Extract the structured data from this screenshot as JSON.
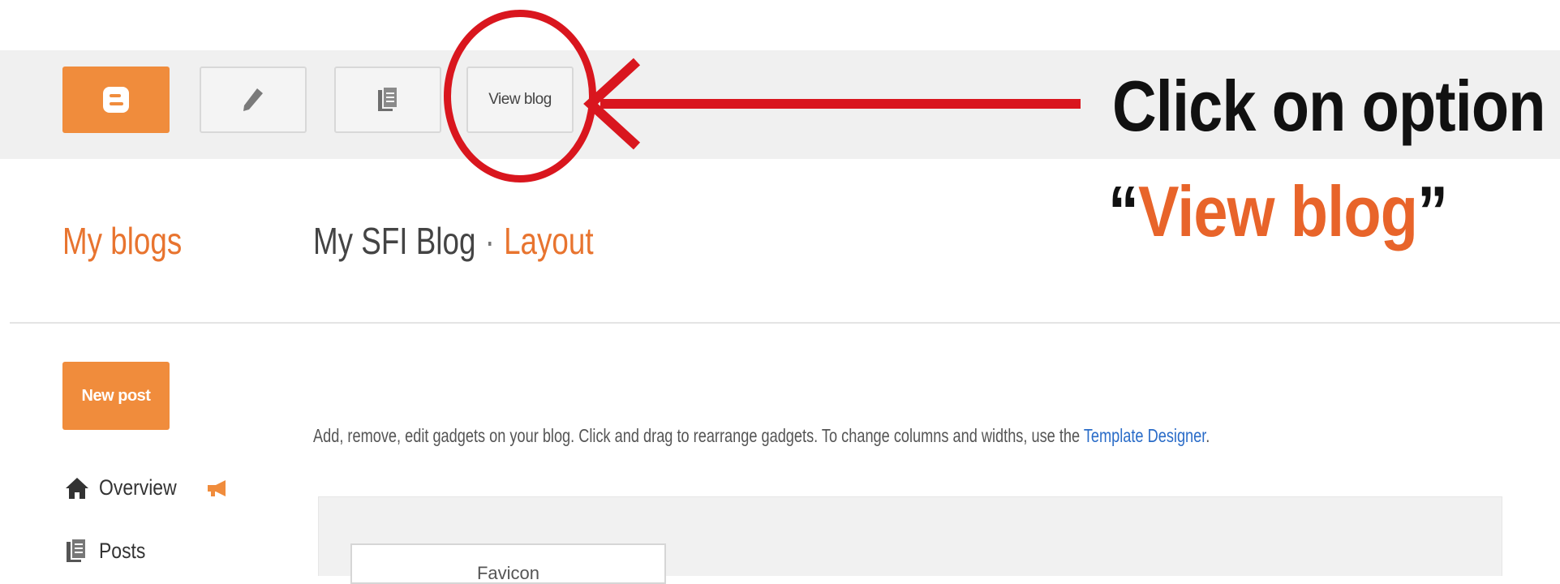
{
  "toolbar": {
    "blogger_logo": "blogger-logo-icon",
    "edit_icon": "pencil-icon",
    "pages_icon": "document-icon",
    "view_blog_label": "View blog"
  },
  "annotation": {
    "line1": "Click on option",
    "line2_open_quote": "“",
    "line2_highlight": "View blog",
    "line2_close_quote": "”",
    "circle_color": "#d9161e",
    "highlight_color": "#e8642a"
  },
  "header": {
    "my_blogs": "My blogs",
    "blog_name": "My SFI Blog",
    "separator": "·",
    "page": "Layout"
  },
  "sidebar": {
    "new_post_label": "New post",
    "items": [
      {
        "label": "Overview",
        "icon": "home-icon",
        "badge_icon": "megaphone-icon"
      },
      {
        "label": "Posts",
        "icon": "posts-icon"
      }
    ]
  },
  "main": {
    "description": "Add, remove, edit gadgets on your blog. Click and drag to rearrange gadgets. To change columns and widths, use the ",
    "template_link": "Template Designer",
    "description_end": ".",
    "gadget_label": "Favicon"
  },
  "colors": {
    "accent": "#f08c3c",
    "link": "#2a6cc8"
  }
}
